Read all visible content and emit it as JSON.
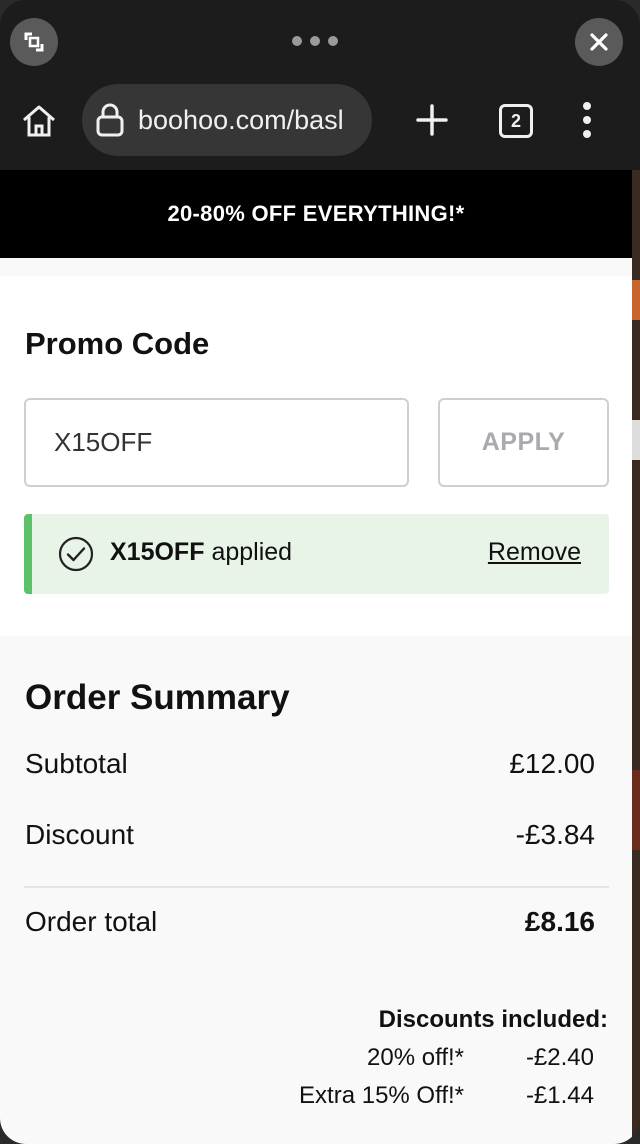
{
  "browser": {
    "url": "boohoo.com/basl",
    "tab_count": "2",
    "icons": {
      "minimize": "resize-icon",
      "menu": "more-horizontal-icon",
      "close": "close-icon",
      "home": "home-icon",
      "lock": "lock-icon",
      "new_tab": "plus-icon",
      "tabs": "tabs-icon",
      "overflow": "more-vertical-icon"
    }
  },
  "banner": {
    "text": "20-80% OFF EVERYTHING!*"
  },
  "promo": {
    "title": "Promo Code",
    "input_value": "X15OFF",
    "apply_label": "APPLY",
    "applied_code": "X15OFF",
    "applied_suffix": "applied",
    "remove_label": "Remove"
  },
  "summary": {
    "title": "Order Summary",
    "subtotal_label": "Subtotal",
    "subtotal_value": "£12.00",
    "discount_label": "Discount",
    "discount_value": "-£3.84",
    "total_label": "Order total",
    "total_value": "£8.16"
  },
  "discounts": {
    "title": "Discounts included:",
    "items": [
      {
        "label": "20% off!*",
        "value": "-£2.40"
      },
      {
        "label": "Extra 15% Off!*",
        "value": "-£1.44"
      }
    ]
  },
  "colors": {
    "applied_bg": "#e9f4e9",
    "applied_accent": "#5cc26a",
    "browser_bg": "#1c1c1c",
    "banner_bg": "#000000"
  }
}
